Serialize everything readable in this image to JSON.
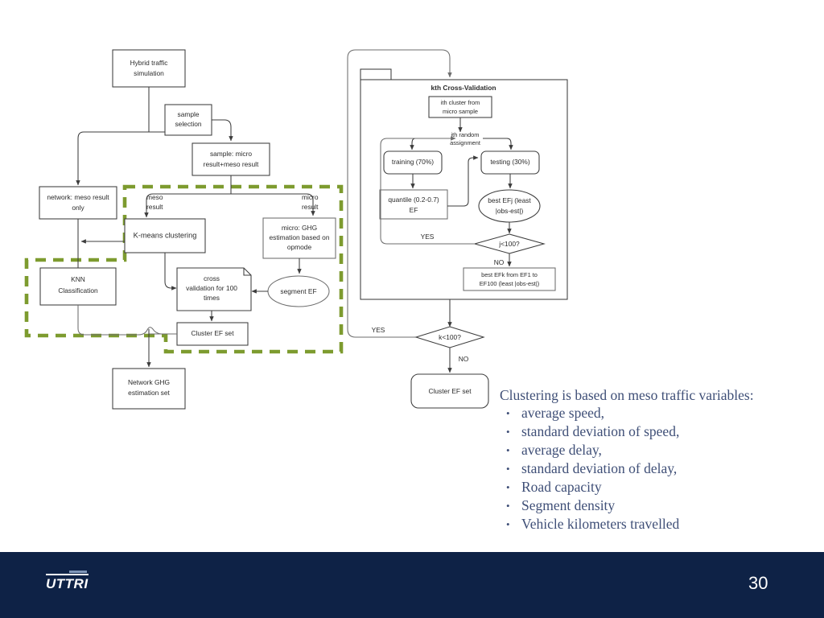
{
  "slide": {
    "page_number": "30",
    "logo_text": "UTTRI"
  },
  "text_block": {
    "intro": "Clustering is based on meso traffic variables:",
    "bullet_glyph": "•",
    "bullets": [
      "average speed,",
      "standard deviation of speed,",
      "average delay,",
      "standard deviation of delay,",
      "Road capacity",
      "Segment density",
      "Vehicle kilometers travelled"
    ]
  },
  "colors": {
    "footer_navy": "#0e2246",
    "text_blue": "#3f4f77",
    "dashed_green": "#7d9b2f",
    "stroke_gray": "#3c3c3c"
  },
  "left_flowchart": {
    "nodes": {
      "hybrid_sim": "Hybrid traffic simulation",
      "hybrid_sim_l1": "Hybrid traffic",
      "hybrid_sim_l2": "simulation",
      "sample_selection_l1": "sample",
      "sample_selection_l2": "selection",
      "sample_micro_l1": "sample: micro",
      "sample_micro_l2": "result+meso result",
      "network_meso_l1": "network: meso result",
      "network_meso_l2": "only",
      "kmeans": "K-means clustering",
      "micro_ghg_l1": "micro: GHG",
      "micro_ghg_l2": "estimation based on",
      "micro_ghg_l3": "opmode",
      "knn_l1": "KNN",
      "knn_l2": "Classification",
      "cross_val_l1": "cross",
      "cross_val_l2": "validation for 100",
      "cross_val_l3": "times",
      "segment_ef": "segment EF",
      "cluster_ef_set": "Cluster EF set",
      "network_ghg_l1": "Network GHG",
      "network_ghg_l2": "estimation set"
    },
    "edge_labels": {
      "meso_l1": "meso",
      "meso_l2": "result",
      "micro_l1": "micro",
      "micro_l2": "result"
    }
  },
  "right_flowchart": {
    "title": "kth Cross-Validation",
    "nodes": {
      "ith_cluster_l1": "ith cluster from",
      "ith_cluster_l2": "micro sample",
      "jth_random_l1": "jth random",
      "jth_random_l2": "assignment",
      "training": "training (70%)",
      "testing": "testing (30%)",
      "quantile_l1": "quantile (0.2-0.7)",
      "quantile_l2": "EF",
      "best_efj_l1": "best EFj (least",
      "best_efj_l2": "|obs-est|)",
      "decision_j": "j<100?",
      "best_efk_l1": "best EFk from EF1 to",
      "best_efk_l2": "EF100 (least |obs-est|)",
      "decision_k": "k<100?",
      "cluster_ef_set": "Cluster EF set"
    },
    "edge_labels": {
      "yes_inner": "YES",
      "no_inner": "NO",
      "yes_outer": "YES",
      "no_outer": "NO"
    }
  }
}
